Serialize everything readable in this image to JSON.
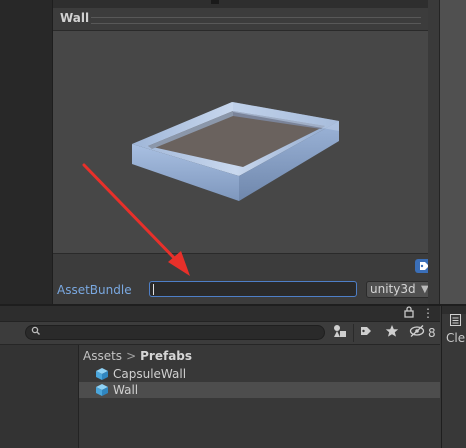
{
  "preview": {
    "title": "Wall",
    "menu_icon": "⋮",
    "tag_icon": "tag-icon"
  },
  "assetbundle": {
    "label": "AssetBundle",
    "value": "",
    "variant": "unity3d"
  },
  "project": {
    "lock_icon": "🔒",
    "menu_icon": "⋮",
    "search": {
      "value": "",
      "icon": "search-icon"
    },
    "hidden_count": "8",
    "breadcrumb": {
      "root": "Assets",
      "separator": ">",
      "current": "Prefabs"
    },
    "items": [
      {
        "name": "CapsuleWall",
        "icon": "prefab-cube-icon",
        "selected": false
      },
      {
        "name": "Wall",
        "icon": "prefab-cube-icon",
        "selected": true
      }
    ]
  },
  "right_panel": {
    "icon": "console-icon",
    "text": "Cle"
  },
  "colors": {
    "accent": "#4e7fc7",
    "label_blue": "#7aa8e0",
    "annotation_arrow": "#e8302a"
  }
}
